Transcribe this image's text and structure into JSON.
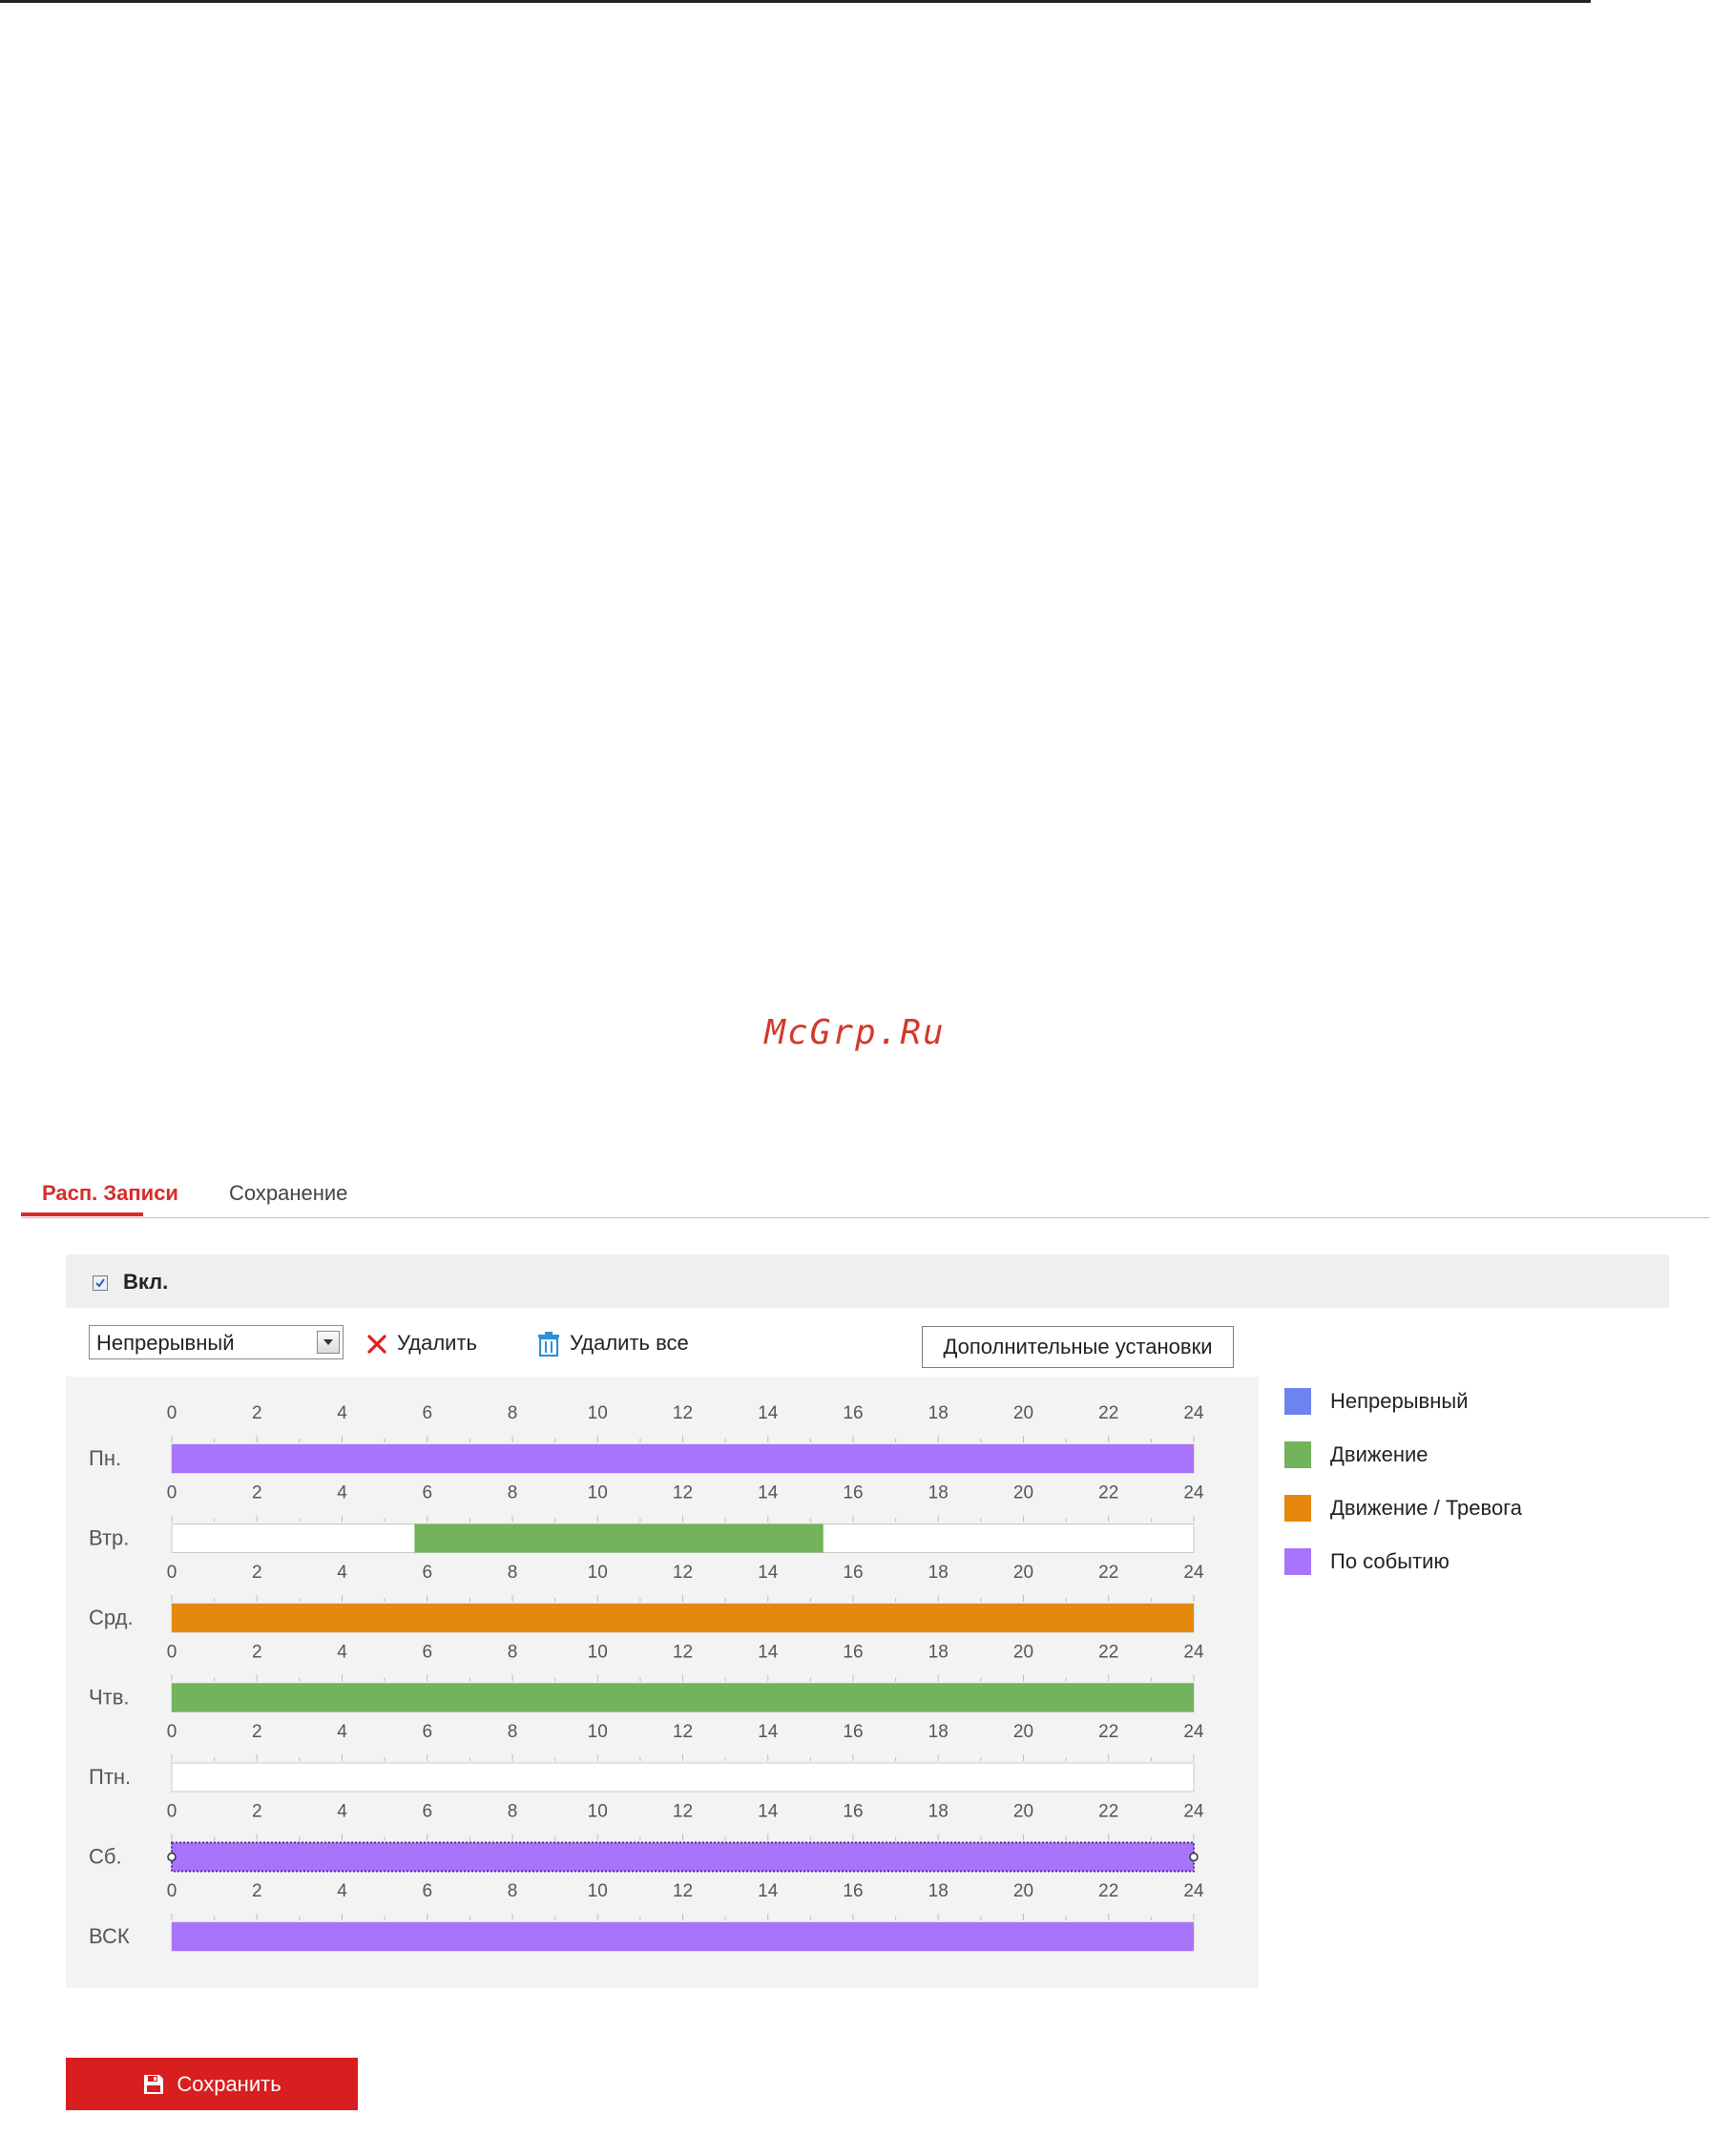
{
  "watermark": "McGrp.Ru",
  "tabs": [
    {
      "label": "Расп. Записи",
      "active": true
    },
    {
      "label": "Сохранение",
      "active": false
    }
  ],
  "enable": {
    "label": "Вкл.",
    "checked": true
  },
  "toolbar": {
    "record_type_selected": "Непрерывный",
    "delete_label": "Удалить",
    "delete_all_label": "Удалить все",
    "advanced_label": "Дополнительные установки"
  },
  "schedule": {
    "hour_ticks": [
      "0",
      "2",
      "4",
      "6",
      "8",
      "10",
      "12",
      "14",
      "16",
      "18",
      "20",
      "22",
      "24"
    ],
    "days": [
      {
        "label": "Пн.",
        "segments": [
          {
            "start": 0,
            "end": 24,
            "type": "event"
          }
        ]
      },
      {
        "label": "Втр.",
        "segments": [
          {
            "start": 5.7,
            "end": 15.3,
            "type": "motion"
          }
        ]
      },
      {
        "label": "Срд.",
        "segments": [
          {
            "start": 0,
            "end": 24,
            "type": "motion_alarm"
          }
        ]
      },
      {
        "label": "Чтв.",
        "segments": [
          {
            "start": 0,
            "end": 24,
            "type": "motion"
          }
        ]
      },
      {
        "label": "Птн.",
        "segments": []
      },
      {
        "label": "Сб.",
        "segments": [
          {
            "start": 0,
            "end": 24,
            "type": "event",
            "selected": true
          }
        ]
      },
      {
        "label": "ВСК",
        "segments": [
          {
            "start": 0,
            "end": 24,
            "type": "event"
          }
        ]
      }
    ]
  },
  "legend": [
    {
      "key": "continuous",
      "label": "Непрерывный",
      "color": "#6d84ec"
    },
    {
      "key": "motion",
      "label": "Движение",
      "color": "#72b35b"
    },
    {
      "key": "motion_alarm",
      "label": "Движение / Тревога",
      "color": "#e5890c"
    },
    {
      "key": "event",
      "label": "По событию",
      "color": "#a874fb"
    }
  ],
  "save_label": "Сохранить",
  "icons": {
    "checkbox": "checkmark-icon",
    "select": "chevron-down-icon",
    "delete": "close-icon",
    "delete_all": "trash-icon",
    "save": "floppy-disk-icon"
  }
}
